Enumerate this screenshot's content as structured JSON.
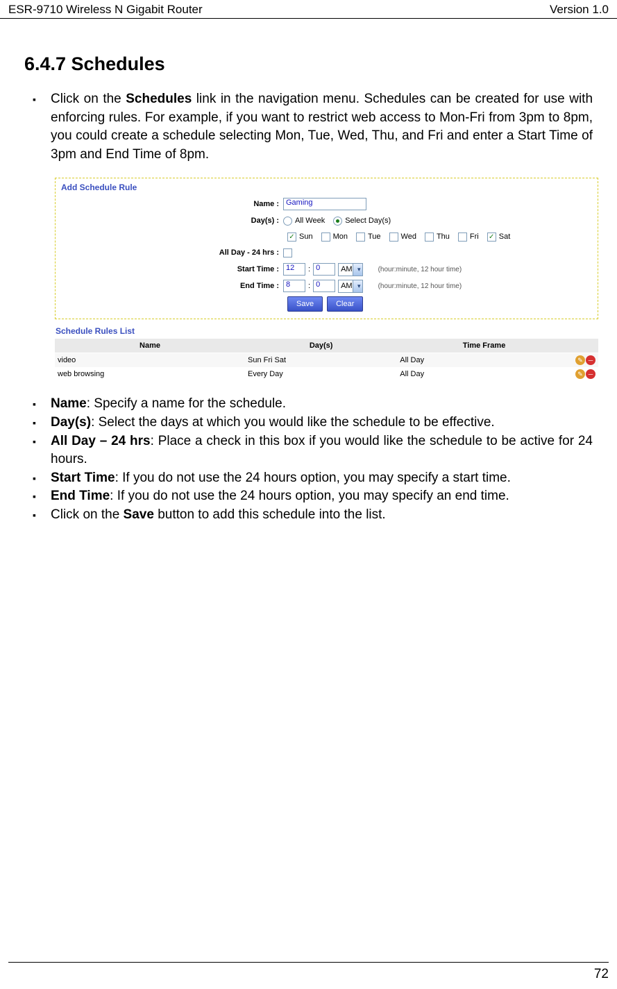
{
  "header": {
    "left": "ESR-9710 Wireless N Gigabit Router",
    "right": "Version 1.0"
  },
  "title": "6.4.7 Schedules",
  "intro": {
    "pre": "Click on the ",
    "bold": "Schedules",
    "post": " link in the navigation menu. Schedules can be created for use with enforcing rules. For example, if you want to restrict web access to Mon-Fri from 3pm to 8pm, you could create a schedule selecting Mon, Tue, Wed, Thu, and Fri and enter a Start Time of 3pm and End Time of 8pm."
  },
  "figure": {
    "panel1_title": "Add Schedule Rule",
    "labels": {
      "name": "Name :",
      "days": "Day(s) :",
      "allday": "All Day - 24 hrs :",
      "start": "Start Time :",
      "end": "End Time :"
    },
    "name_value": "Gaming",
    "radio_all": "All Week",
    "radio_select": "Select Day(s)",
    "days": [
      "Sun",
      "Mon",
      "Tue",
      "Wed",
      "Thu",
      "Fri",
      "Sat"
    ],
    "days_checked": [
      true,
      false,
      false,
      false,
      false,
      false,
      true
    ],
    "allday_checked": false,
    "start": {
      "h": "12",
      "m": "0",
      "ampm": "AM"
    },
    "end": {
      "h": "8",
      "m": "0",
      "ampm": "AM"
    },
    "hint": "(hour:minute, 12 hour time)",
    "save": "Save",
    "clear": "Clear",
    "panel2_title": "Schedule Rules List",
    "cols": [
      "Name",
      "Day(s)",
      "Time Frame"
    ],
    "rows": [
      {
        "name": "video",
        "days": "Sun Fri Sat",
        "tf": "All Day"
      },
      {
        "name": "web browsing",
        "days": "Every Day",
        "tf": "All Day"
      }
    ]
  },
  "defs": {
    "name_b": "Name",
    "name_t": ": Specify a name for the schedule.",
    "days_b": "Day(s)",
    "days_t": ": Select the days at which you would like the schedule to be effective.",
    "allday_b": "All Day – 24 hrs",
    "allday_t": ": Place a check in this box if you would like the schedule to be active for 24 hours.",
    "start_b": "Start Time",
    "start_t": ": If you do not use the 24 hours option, you may specify a start time.",
    "end_b": "End Time",
    "end_t": ": If you do not use the 24 hours option, you may specify an end time.",
    "save_pre": "Click on the ",
    "save_b": "Save",
    "save_t": " button to add this schedule into the list."
  },
  "page": "72"
}
